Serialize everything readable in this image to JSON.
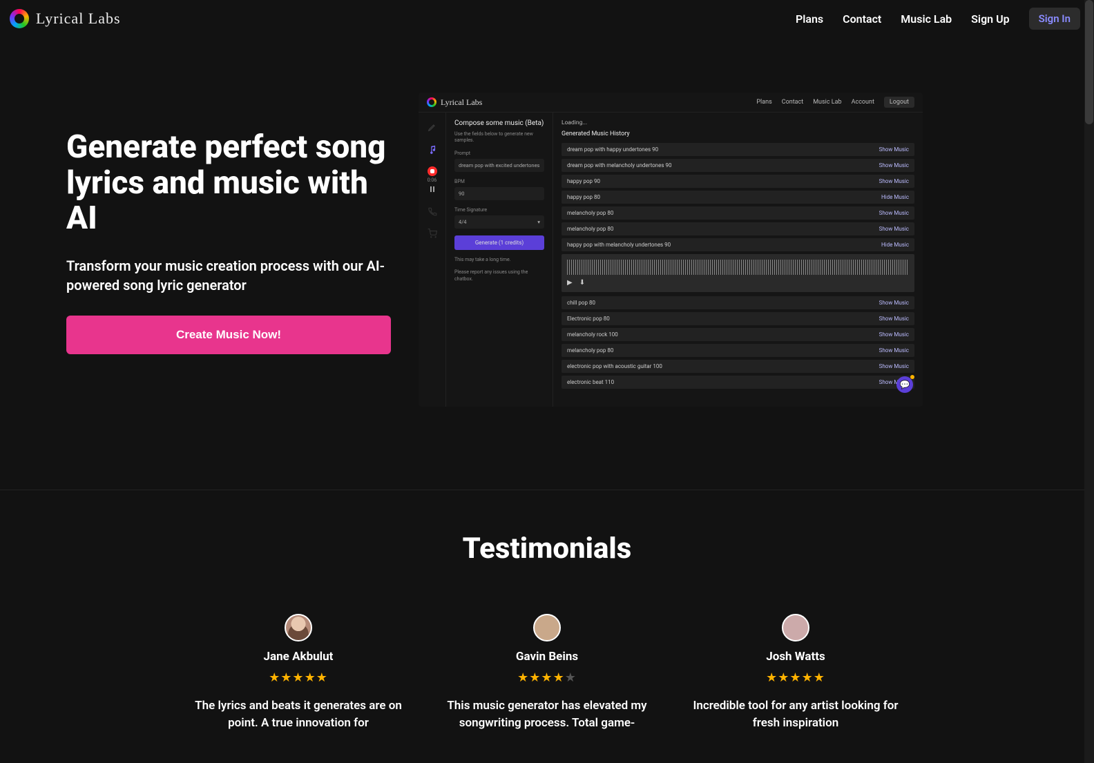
{
  "brand": {
    "name": "Lyrical Labs"
  },
  "nav": {
    "links": [
      "Plans",
      "Contact",
      "Music Lab",
      "Sign Up"
    ],
    "signin": "Sign In"
  },
  "hero": {
    "title": "Generate perfect song lyrics and music with AI",
    "subtitle": "Transform your music creation process with our AI-powered song lyric generator",
    "cta": "Create Music Now!"
  },
  "app": {
    "nav": {
      "items": [
        "Plans",
        "Contact",
        "Music Lab",
        "Account"
      ],
      "logout": "Logout"
    },
    "rec_time": "0:06",
    "compose": {
      "title": "Compose some music (Beta)",
      "hint": "Use the fields below to generate new samples.",
      "prompt_label": "Prompt",
      "prompt_value": "dream pop with excited undertones",
      "bpm_label": "BPM",
      "bpm_value": "90",
      "ts_label": "Time Signature",
      "ts_value": "4/4",
      "generate": "Generate (1 credits)",
      "note1": "This may take a long time.",
      "note2": "Please report any issues using the chatbox."
    },
    "history": {
      "loading": "Loading...",
      "heading": "Generated Music History",
      "show": "Show Music",
      "hide": "Hide Music",
      "items": [
        {
          "name": "dream pop with happy undertones 90",
          "action": "show"
        },
        {
          "name": "dream pop with melancholy undertones 90",
          "action": "show"
        },
        {
          "name": "happy pop 90",
          "action": "show"
        },
        {
          "name": "happy pop 80",
          "action": "hide"
        },
        {
          "name": "melancholy pop 80",
          "action": "show"
        },
        {
          "name": "melancholy pop 80",
          "action": "show"
        },
        {
          "name": "happy pop with melancholy undertones 90",
          "action": "hide",
          "expanded": true
        },
        {
          "name": "chill pop 80",
          "action": "show"
        },
        {
          "name": "Electronic pop 80",
          "action": "show"
        },
        {
          "name": "melancholy rock 100",
          "action": "show"
        },
        {
          "name": "melancholy pop 80",
          "action": "show"
        },
        {
          "name": "electronic pop with acoustic guitar 100",
          "action": "show"
        },
        {
          "name": "electronic beat 110",
          "action": "show"
        }
      ]
    }
  },
  "testimonials": {
    "heading": "Testimonials",
    "items": [
      {
        "name": "Jane Akbulut",
        "stars": 5,
        "text": "The lyrics and beats it generates are on point. A true innovation for"
      },
      {
        "name": "Gavin Beins",
        "stars": 4,
        "text": "This music generator has elevated my songwriting process. Total game-"
      },
      {
        "name": "Josh Watts",
        "stars": 5,
        "text": "Incredible tool for any artist looking for fresh inspiration"
      }
    ]
  }
}
